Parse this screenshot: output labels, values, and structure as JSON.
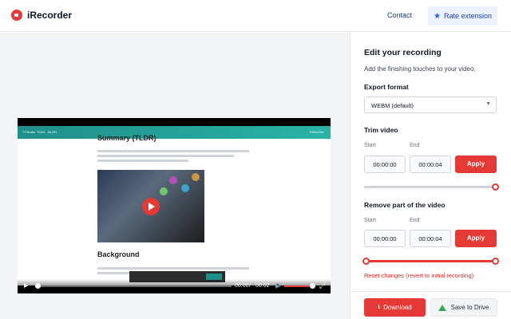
{
  "header": {
    "app_name": "iRecorder",
    "contact": "Contact",
    "rate": "Rate extension",
    "logo_icon": "record-icon",
    "rate_icon": "star-icon"
  },
  "video": {
    "site_nav": [
      "TTStudio",
      "TOOL",
      "BLOG",
      "ENGLISH"
    ],
    "heading": "Summary (TLDR)",
    "heading2": "Background",
    "current_time": "00:00",
    "duration": "00:02",
    "cookie_button": "ACCEPT",
    "playback_progress": 0.1
  },
  "panel": {
    "title": "Edit your recording",
    "subtitle": "Add the finishing touches to your video.",
    "export": {
      "title": "Export format",
      "value": "WEBM (default)"
    },
    "trim": {
      "title": "Trim video",
      "start_label": "Start",
      "end_label": "End",
      "start": "00:00:00",
      "end": "00:00:04",
      "apply": "Apply"
    },
    "remove": {
      "title": "Remove part of the video",
      "start_label": "Start",
      "end_label": "End",
      "start": "00:00:00",
      "end": "00:00:04",
      "apply": "Apply"
    },
    "reset": "Reset changes (revert to initial recording)",
    "download": "Download",
    "drive": "Save to Drive"
  },
  "colors": {
    "accent": "#e53935",
    "primary": "#1e40af"
  }
}
